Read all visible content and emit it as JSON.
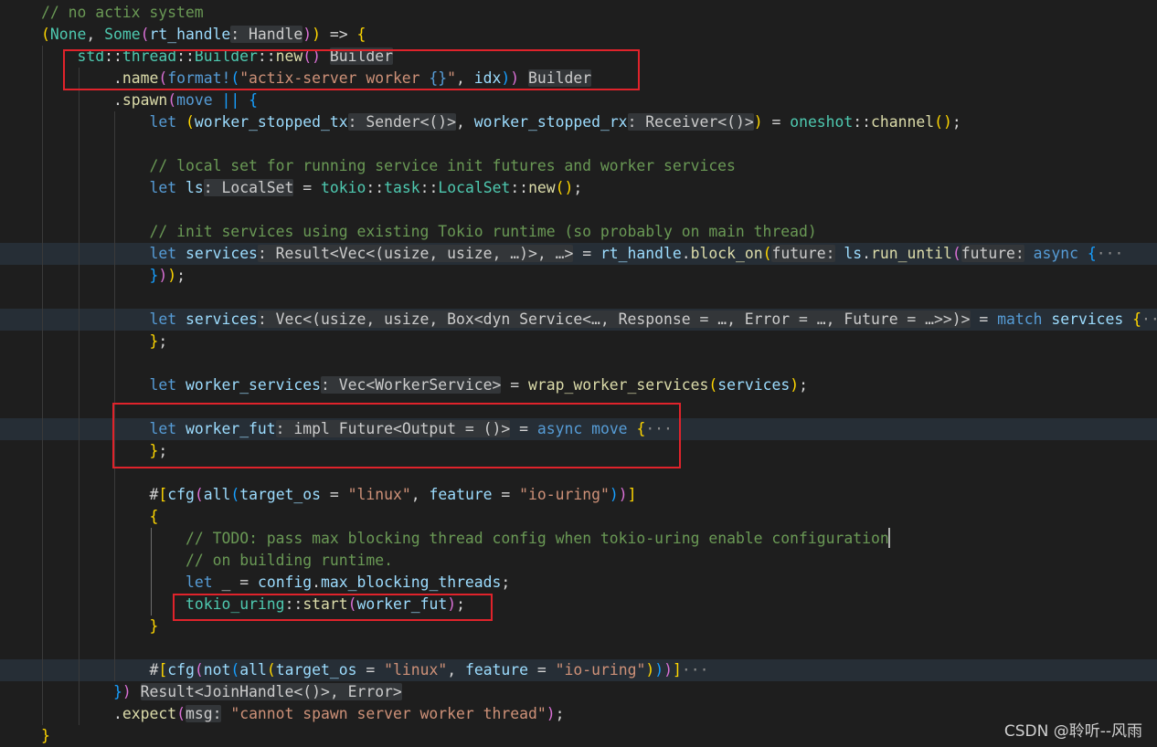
{
  "editor": {
    "lines": [
      {
        "indent": 0,
        "segs": [
          [
            "cm",
            "// no actix system"
          ]
        ]
      },
      {
        "indent": 0,
        "segs": [
          [
            "b1",
            "("
          ],
          [
            "ty",
            "None"
          ],
          [
            "pn",
            ", "
          ],
          [
            "ty",
            "Some"
          ],
          [
            "b2",
            "("
          ],
          [
            "vr",
            "rt_handle"
          ],
          [
            "ih",
            ": Handle"
          ],
          [
            "b2",
            ")"
          ],
          [
            "b1",
            ")"
          ],
          [
            "pn",
            " => "
          ],
          [
            "b1",
            "{"
          ]
        ]
      },
      {
        "indent": 1,
        "segs": [
          [
            "ty",
            "std"
          ],
          [
            "pn",
            "::"
          ],
          [
            "ty",
            "thread"
          ],
          [
            "pn",
            "::"
          ],
          [
            "ty",
            "Builder"
          ],
          [
            "pn",
            "::"
          ],
          [
            "fn",
            "new"
          ],
          [
            "b2",
            "()"
          ],
          [
            "pn",
            " "
          ],
          [
            "ih",
            "Builder"
          ]
        ]
      },
      {
        "indent": 2,
        "segs": [
          [
            "pn",
            "."
          ],
          [
            "fn",
            "name"
          ],
          [
            "b2",
            "("
          ],
          [
            "ma",
            "format!"
          ],
          [
            "b3",
            "("
          ],
          [
            "st",
            "\"actix-server worker "
          ],
          [
            "kw",
            "{}"
          ],
          [
            "st",
            "\""
          ],
          [
            "pn",
            ", "
          ],
          [
            "vr",
            "idx"
          ],
          [
            "b3",
            ")"
          ],
          [
            "b2",
            ")"
          ],
          [
            "pn",
            " "
          ],
          [
            "ih",
            "Builder"
          ]
        ]
      },
      {
        "indent": 2,
        "segs": [
          [
            "pn",
            "."
          ],
          [
            "fn",
            "spawn"
          ],
          [
            "b2",
            "("
          ],
          [
            "kw",
            "move"
          ],
          [
            "pn",
            " "
          ],
          [
            "b3",
            "||"
          ],
          [
            "pn",
            " "
          ],
          [
            "b3",
            "{"
          ]
        ]
      },
      {
        "indent": 3,
        "segs": [
          [
            "kw",
            "let"
          ],
          [
            "pn",
            " "
          ],
          [
            "b1",
            "("
          ],
          [
            "vr",
            "worker_stopped_tx"
          ],
          [
            "ih",
            ": Sender<()>"
          ],
          [
            "pn",
            ", "
          ],
          [
            "vr",
            "worker_stopped_rx"
          ],
          [
            "ih",
            ": Receiver<()>"
          ],
          [
            "b1",
            ")"
          ],
          [
            "pn",
            " = "
          ],
          [
            "ty",
            "oneshot"
          ],
          [
            "pn",
            "::"
          ],
          [
            "fn",
            "channel"
          ],
          [
            "b1",
            "()"
          ],
          [
            "pn",
            ";"
          ]
        ]
      },
      {
        "indent": 3,
        "segs": []
      },
      {
        "indent": 3,
        "segs": [
          [
            "cm",
            "// local set for running service init futures and worker services"
          ]
        ]
      },
      {
        "indent": 3,
        "segs": [
          [
            "kw",
            "let"
          ],
          [
            "pn",
            " "
          ],
          [
            "vr",
            "ls"
          ],
          [
            "ih",
            ": LocalSet"
          ],
          [
            "pn",
            " = "
          ],
          [
            "ty",
            "tokio"
          ],
          [
            "pn",
            "::"
          ],
          [
            "ty",
            "task"
          ],
          [
            "pn",
            "::"
          ],
          [
            "ty",
            "LocalSet"
          ],
          [
            "pn",
            "::"
          ],
          [
            "fn",
            "new"
          ],
          [
            "b1",
            "()"
          ],
          [
            "pn",
            ";"
          ]
        ]
      },
      {
        "indent": 3,
        "segs": []
      },
      {
        "indent": 3,
        "segs": [
          [
            "cm",
            "// init services using existing Tokio runtime (so probably on main thread)"
          ]
        ]
      },
      {
        "indent": 3,
        "hl": true,
        "segs": [
          [
            "kw",
            "let"
          ],
          [
            "pn",
            " "
          ],
          [
            "vr",
            "services"
          ],
          [
            "ih",
            ": Result<Vec<(usize, usize, …)>, …>"
          ],
          [
            "pn",
            " = "
          ],
          [
            "vr",
            "rt_handle"
          ],
          [
            "pn",
            "."
          ],
          [
            "fn",
            "block_on"
          ],
          [
            "b1",
            "("
          ],
          [
            "ih",
            "future:"
          ],
          [
            "pn",
            " "
          ],
          [
            "vr",
            "ls"
          ],
          [
            "pn",
            "."
          ],
          [
            "fn",
            "run_until"
          ],
          [
            "b2",
            "("
          ],
          [
            "ih",
            "future:"
          ],
          [
            "pn",
            " "
          ],
          [
            "kw",
            "async"
          ],
          [
            "pn",
            " "
          ],
          [
            "b3",
            "{"
          ],
          [
            "ell",
            "···"
          ]
        ]
      },
      {
        "indent": 3,
        "segs": [
          [
            "b3",
            "}"
          ],
          [
            "b2",
            ")"
          ],
          [
            "b1",
            ")"
          ],
          [
            "pn",
            ";"
          ]
        ]
      },
      {
        "indent": 3,
        "segs": []
      },
      {
        "indent": 3,
        "hl": true,
        "segs": [
          [
            "kw",
            "let"
          ],
          [
            "pn",
            " "
          ],
          [
            "vr",
            "services"
          ],
          [
            "ih",
            ": Vec<(usize, usize, Box<dyn Service<…, Response = …, Error = …, Future = …>>)>"
          ],
          [
            "pn",
            " = "
          ],
          [
            "kw",
            "match"
          ],
          [
            "pn",
            " "
          ],
          [
            "vr",
            "services"
          ],
          [
            "pn",
            " "
          ],
          [
            "b1",
            "{"
          ],
          [
            "ell",
            "···"
          ]
        ]
      },
      {
        "indent": 3,
        "segs": [
          [
            "b1",
            "}"
          ],
          [
            "pn",
            ";"
          ]
        ]
      },
      {
        "indent": 3,
        "segs": []
      },
      {
        "indent": 3,
        "segs": [
          [
            "kw",
            "let"
          ],
          [
            "pn",
            " "
          ],
          [
            "vr",
            "worker_services"
          ],
          [
            "ih",
            ": Vec<WorkerService>"
          ],
          [
            "pn",
            " = "
          ],
          [
            "fn",
            "wrap_worker_services"
          ],
          [
            "b1",
            "("
          ],
          [
            "vr",
            "services"
          ],
          [
            "b1",
            ")"
          ],
          [
            "pn",
            ";"
          ]
        ]
      },
      {
        "indent": 3,
        "segs": []
      },
      {
        "indent": 3,
        "hl": true,
        "segs": [
          [
            "kw",
            "let"
          ],
          [
            "pn",
            " "
          ],
          [
            "vr",
            "worker_fut"
          ],
          [
            "ih",
            ": impl Future<Output = ()>"
          ],
          [
            "pn",
            " = "
          ],
          [
            "kw",
            "async"
          ],
          [
            "pn",
            " "
          ],
          [
            "kw",
            "move"
          ],
          [
            "pn",
            " "
          ],
          [
            "b1",
            "{"
          ],
          [
            "ell",
            "···"
          ]
        ]
      },
      {
        "indent": 3,
        "segs": [
          [
            "b1",
            "}"
          ],
          [
            "pn",
            ";"
          ]
        ]
      },
      {
        "indent": 3,
        "segs": []
      },
      {
        "indent": 3,
        "segs": [
          [
            "pn",
            "#"
          ],
          [
            "b1",
            "["
          ],
          [
            "vr",
            "cfg"
          ],
          [
            "b2",
            "("
          ],
          [
            "vr",
            "all"
          ],
          [
            "b3",
            "("
          ],
          [
            "vr",
            "target_os"
          ],
          [
            "pn",
            " = "
          ],
          [
            "st",
            "\"linux\""
          ],
          [
            "pn",
            ", "
          ],
          [
            "vr",
            "feature"
          ],
          [
            "pn",
            " = "
          ],
          [
            "st",
            "\"io-uring\""
          ],
          [
            "b3",
            ")"
          ],
          [
            "b2",
            ")"
          ],
          [
            "b1",
            "]"
          ]
        ]
      },
      {
        "indent": 3,
        "segs": [
          [
            "b1",
            "{"
          ]
        ]
      },
      {
        "indent": 4,
        "segs": [
          [
            "cm",
            "// TODO: pass max blocking thread config when tokio-uring enable configuration"
          ]
        ]
      },
      {
        "indent": 4,
        "segs": [
          [
            "cm",
            "// on building runtime."
          ]
        ]
      },
      {
        "indent": 4,
        "segs": [
          [
            "kw",
            "let"
          ],
          [
            "pn",
            " _ = "
          ],
          [
            "vr",
            "config"
          ],
          [
            "pn",
            "."
          ],
          [
            "vr",
            "max_blocking_threads"
          ],
          [
            "pn",
            ";"
          ]
        ]
      },
      {
        "indent": 4,
        "segs": [
          [
            "ty",
            "tokio_uring"
          ],
          [
            "pn",
            "::"
          ],
          [
            "fn",
            "start"
          ],
          [
            "b2",
            "("
          ],
          [
            "vr",
            "worker_fut"
          ],
          [
            "b2",
            ")"
          ],
          [
            "pn",
            ";"
          ]
        ]
      },
      {
        "indent": 3,
        "segs": [
          [
            "b1",
            "}"
          ]
        ]
      },
      {
        "indent": 3,
        "segs": []
      },
      {
        "indent": 3,
        "hl": true,
        "segs": [
          [
            "pn",
            "#"
          ],
          [
            "b1",
            "["
          ],
          [
            "vr",
            "cfg"
          ],
          [
            "b2",
            "("
          ],
          [
            "vr",
            "not"
          ],
          [
            "b3",
            "("
          ],
          [
            "vr",
            "all"
          ],
          [
            "b1",
            "("
          ],
          [
            "vr",
            "target_os"
          ],
          [
            "pn",
            " = "
          ],
          [
            "st",
            "\"linux\""
          ],
          [
            "pn",
            ", "
          ],
          [
            "vr",
            "feature"
          ],
          [
            "pn",
            " = "
          ],
          [
            "st",
            "\"io-uring\""
          ],
          [
            "b1",
            ")"
          ],
          [
            "b3",
            ")"
          ],
          [
            "b2",
            ")"
          ],
          [
            "b1",
            "]"
          ],
          [
            "ell",
            "···"
          ]
        ]
      },
      {
        "indent": 2,
        "segs": [
          [
            "b3",
            "}"
          ],
          [
            "b2",
            ")"
          ],
          [
            "pn",
            " "
          ],
          [
            "ih",
            "Result<JoinHandle<()>, Error>"
          ]
        ]
      },
      {
        "indent": 2,
        "segs": [
          [
            "pn",
            "."
          ],
          [
            "fn",
            "expect"
          ],
          [
            "b2",
            "("
          ],
          [
            "ih",
            "msg:"
          ],
          [
            "pn",
            " "
          ],
          [
            "st",
            "\"cannot spawn server worker thread\""
          ],
          [
            "b2",
            ")"
          ],
          [
            "pn",
            ";"
          ]
        ]
      },
      {
        "indent": 0,
        "segs": [
          [
            "b1",
            "}"
          ]
        ]
      }
    ]
  },
  "colors": {
    "background": "#1e1e1e",
    "highlight_box": "#e0232b"
  },
  "watermark": "CSDN @聆听--风雨"
}
